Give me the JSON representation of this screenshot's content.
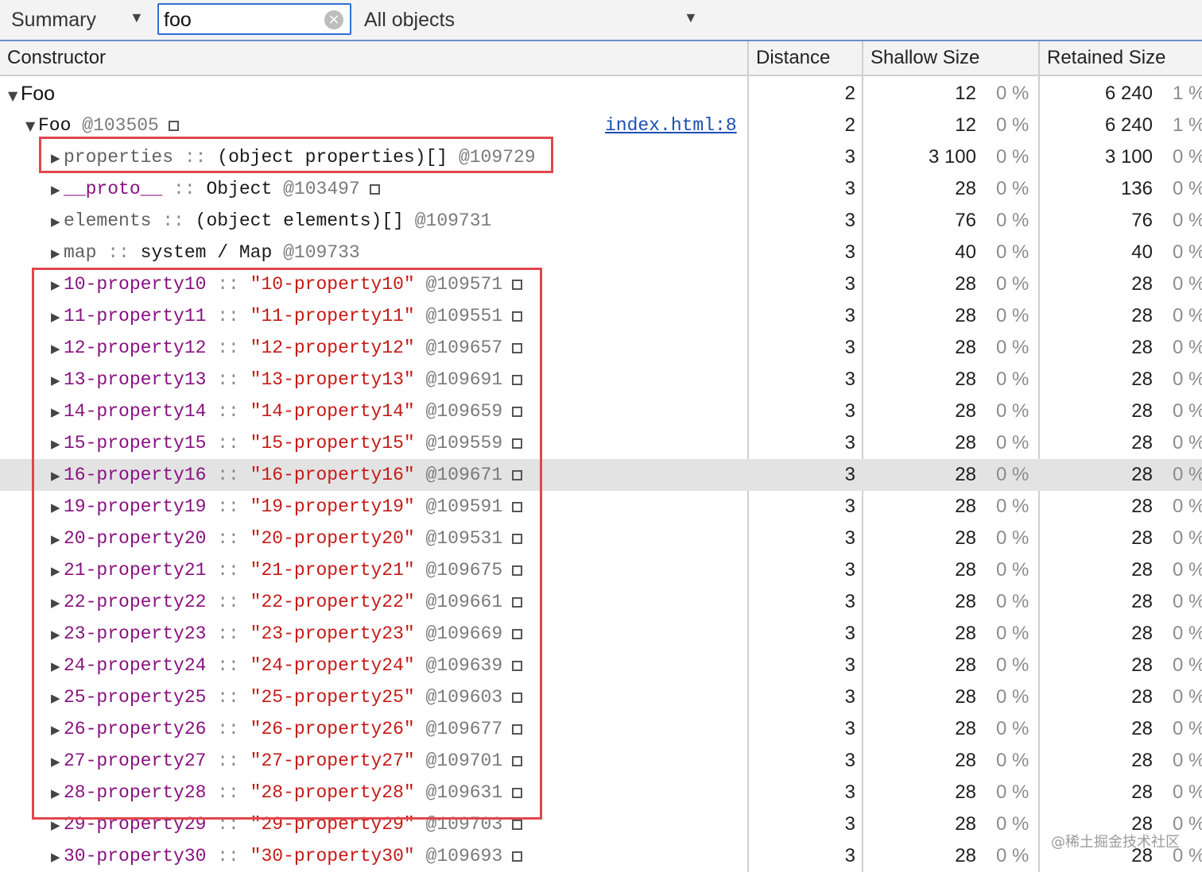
{
  "toolbar": {
    "view": "Summary",
    "search_value": "foo",
    "search_clear_glyph": "×",
    "filter": "All objects"
  },
  "columns": {
    "constructor": "Constructor",
    "distance": "Distance",
    "shallow": "Shallow Size",
    "retained": "Retained Size"
  },
  "rows": [
    {
      "kind": "root",
      "name": "Foo",
      "expanded": true,
      "distance": "2",
      "shallow": "12",
      "shallow_pct": "0 %",
      "retained": "6 240",
      "retained_pct": "1 %"
    },
    {
      "kind": "instance",
      "ctor": "Foo",
      "id": "@103505",
      "expanded": true,
      "link": "index.html:8",
      "distance": "2",
      "shallow": "12",
      "shallow_pct": "0 %",
      "retained": "6 240",
      "retained_pct": "1 %"
    },
    {
      "kind": "system",
      "prop": "properties",
      "sep": "::",
      "value": "(object properties)[]",
      "id": "@109729",
      "distance": "3",
      "shallow": "3 100",
      "shallow_pct": "0 %",
      "retained": "3 100",
      "retained_pct": "0 %"
    },
    {
      "kind": "proto",
      "prop": "__proto__",
      "sep": "::",
      "value": "Object",
      "id": "@103497",
      "distance": "3",
      "shallow": "28",
      "shallow_pct": "0 %",
      "retained": "136",
      "retained_pct": "0 %"
    },
    {
      "kind": "system",
      "prop": "elements",
      "sep": "::",
      "value": "(object elements)[]",
      "id": "@109731",
      "distance": "3",
      "shallow": "76",
      "shallow_pct": "0 %",
      "retained": "76",
      "retained_pct": "0 %"
    },
    {
      "kind": "system",
      "prop": "map",
      "sep": "::",
      "value": "system / Map",
      "id": "@109733",
      "distance": "3",
      "shallow": "40",
      "shallow_pct": "0 %",
      "retained": "40",
      "retained_pct": "0 %"
    },
    {
      "kind": "prop",
      "prop": "10-property10",
      "sep": "::",
      "value": "\"10-property10\"",
      "id": "@109571",
      "distance": "3",
      "shallow": "28",
      "shallow_pct": "0 %",
      "retained": "28",
      "retained_pct": "0 %"
    },
    {
      "kind": "prop",
      "prop": "11-property11",
      "sep": "::",
      "value": "\"11-property11\"",
      "id": "@109551",
      "distance": "3",
      "shallow": "28",
      "shallow_pct": "0 %",
      "retained": "28",
      "retained_pct": "0 %"
    },
    {
      "kind": "prop",
      "prop": "12-property12",
      "sep": "::",
      "value": "\"12-property12\"",
      "id": "@109657",
      "distance": "3",
      "shallow": "28",
      "shallow_pct": "0 %",
      "retained": "28",
      "retained_pct": "0 %"
    },
    {
      "kind": "prop",
      "prop": "13-property13",
      "sep": "::",
      "value": "\"13-property13\"",
      "id": "@109691",
      "distance": "3",
      "shallow": "28",
      "shallow_pct": "0 %",
      "retained": "28",
      "retained_pct": "0 %"
    },
    {
      "kind": "prop",
      "prop": "14-property14",
      "sep": "::",
      "value": "\"14-property14\"",
      "id": "@109659",
      "distance": "3",
      "shallow": "28",
      "shallow_pct": "0 %",
      "retained": "28",
      "retained_pct": "0 %"
    },
    {
      "kind": "prop",
      "prop": "15-property15",
      "sep": "::",
      "value": "\"15-property15\"",
      "id": "@109559",
      "distance": "3",
      "shallow": "28",
      "shallow_pct": "0 %",
      "retained": "28",
      "retained_pct": "0 %"
    },
    {
      "kind": "prop",
      "prop": "16-property16",
      "sep": "::",
      "value": "\"16-property16\"",
      "id": "@109671",
      "selected": true,
      "distance": "3",
      "shallow": "28",
      "shallow_pct": "0 %",
      "retained": "28",
      "retained_pct": "0 %"
    },
    {
      "kind": "prop",
      "prop": "19-property19",
      "sep": "::",
      "value": "\"19-property19\"",
      "id": "@109591",
      "distance": "3",
      "shallow": "28",
      "shallow_pct": "0 %",
      "retained": "28",
      "retained_pct": "0 %"
    },
    {
      "kind": "prop",
      "prop": "20-property20",
      "sep": "::",
      "value": "\"20-property20\"",
      "id": "@109531",
      "distance": "3",
      "shallow": "28",
      "shallow_pct": "0 %",
      "retained": "28",
      "retained_pct": "0 %"
    },
    {
      "kind": "prop",
      "prop": "21-property21",
      "sep": "::",
      "value": "\"21-property21\"",
      "id": "@109675",
      "distance": "3",
      "shallow": "28",
      "shallow_pct": "0 %",
      "retained": "28",
      "retained_pct": "0 %"
    },
    {
      "kind": "prop",
      "prop": "22-property22",
      "sep": "::",
      "value": "\"22-property22\"",
      "id": "@109661",
      "distance": "3",
      "shallow": "28",
      "shallow_pct": "0 %",
      "retained": "28",
      "retained_pct": "0 %"
    },
    {
      "kind": "prop",
      "prop": "23-property23",
      "sep": "::",
      "value": "\"23-property23\"",
      "id": "@109669",
      "distance": "3",
      "shallow": "28",
      "shallow_pct": "0 %",
      "retained": "28",
      "retained_pct": "0 %"
    },
    {
      "kind": "prop",
      "prop": "24-property24",
      "sep": "::",
      "value": "\"24-property24\"",
      "id": "@109639",
      "distance": "3",
      "shallow": "28",
      "shallow_pct": "0 %",
      "retained": "28",
      "retained_pct": "0 %"
    },
    {
      "kind": "prop",
      "prop": "25-property25",
      "sep": "::",
      "value": "\"25-property25\"",
      "id": "@109603",
      "distance": "3",
      "shallow": "28",
      "shallow_pct": "0 %",
      "retained": "28",
      "retained_pct": "0 %"
    },
    {
      "kind": "prop",
      "prop": "26-property26",
      "sep": "::",
      "value": "\"26-property26\"",
      "id": "@109677",
      "distance": "3",
      "shallow": "28",
      "shallow_pct": "0 %",
      "retained": "28",
      "retained_pct": "0 %"
    },
    {
      "kind": "prop",
      "prop": "27-property27",
      "sep": "::",
      "value": "\"27-property27\"",
      "id": "@109701",
      "distance": "3",
      "shallow": "28",
      "shallow_pct": "0 %",
      "retained": "28",
      "retained_pct": "0 %"
    },
    {
      "kind": "prop",
      "prop": "28-property28",
      "sep": "::",
      "value": "\"28-property28\"",
      "id": "@109631",
      "distance": "3",
      "shallow": "28",
      "shallow_pct": "0 %",
      "retained": "28",
      "retained_pct": "0 %"
    },
    {
      "kind": "prop",
      "prop": "29-property29",
      "sep": "::",
      "value": "\"29-property29\"",
      "id": "@109703",
      "distance": "3",
      "shallow": "28",
      "shallow_pct": "0 %",
      "retained": "28",
      "retained_pct": "0 %"
    },
    {
      "kind": "prop",
      "prop": "30-property30",
      "sep": "::",
      "value": "\"30-property30\"",
      "id": "@109693",
      "distance": "3",
      "shallow": "28",
      "shallow_pct": "0 %",
      "retained": "28",
      "retained_pct": "0 %"
    }
  ],
  "watermark": "@稀土掘金技术社区",
  "colors": {
    "highlight_box": "#e0474c",
    "property_name": "#881280",
    "string_value": "#c41a16",
    "link": "#1a4fb5",
    "selected_row": "#e3e3e3",
    "focus_border": "#2f6fd6"
  }
}
